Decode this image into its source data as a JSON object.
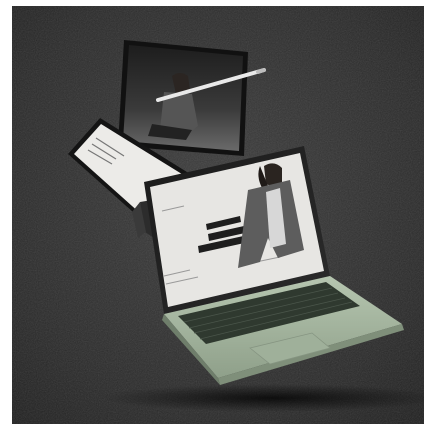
{
  "image": {
    "subject": "floating-devices-mockup",
    "colors": {
      "background": "#2e2e2e",
      "laptop_body": "#a9bba4",
      "keyboard": "#303a30",
      "screen_bg": "#e7e6e3",
      "tablet_bezel": "#161616"
    }
  }
}
